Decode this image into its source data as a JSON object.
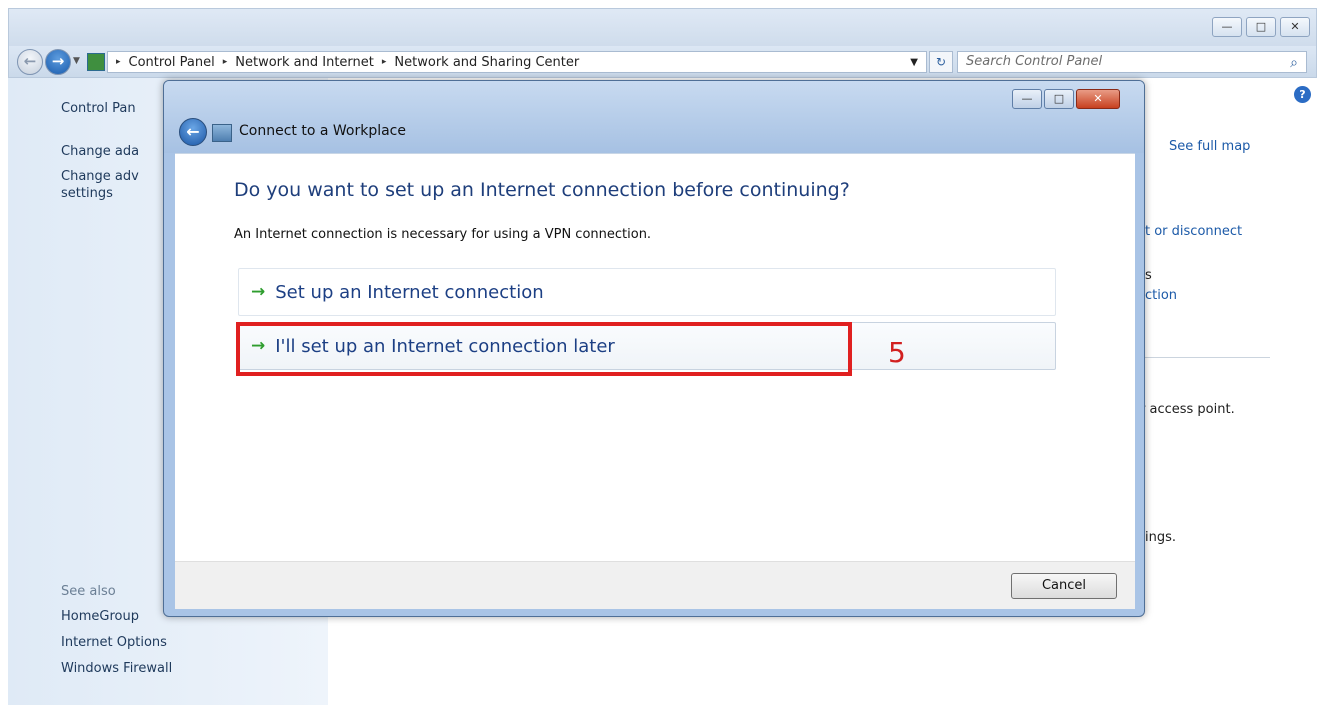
{
  "explorer": {
    "breadcrumb": [
      "Control Panel",
      "Network and Internet",
      "Network and Sharing Center"
    ],
    "search_placeholder": "Search Control Panel",
    "left_pane": {
      "items": [
        "Control Pan",
        "Change ada",
        "Change adv",
        "settings"
      ],
      "see_also_label": "See also",
      "see_also_items": [
        "HomeGroup",
        "Internet Options",
        "Windows Firewall"
      ]
    },
    "background": {
      "see_full_map": "See full map",
      "connect_disconnect": "t or disconnect",
      "fragment_s": "s",
      "fragment_ction": "ction",
      "access_point": "r access point.",
      "ings": "ings."
    }
  },
  "dialog": {
    "title": "Connect to a Workplace",
    "heading": "Do you want to set up an Internet connection before continuing?",
    "description": "An Internet connection is necessary for using a VPN connection.",
    "options": [
      {
        "label": "Set up an Internet connection"
      },
      {
        "label": "I'll set up an Internet connection later"
      }
    ],
    "cancel_label": "Cancel",
    "annotation_number": "5"
  },
  "icons": {
    "arrow": "→",
    "chevron": "▸",
    "back_arrow": "←",
    "minimize": "—",
    "maximize": "□",
    "close": "✕"
  },
  "colors": {
    "accent_link": "#1c5aa8",
    "heading": "#1e3e7b",
    "annotation_red": "#e02020",
    "option_arrow": "#2e9d2e"
  }
}
